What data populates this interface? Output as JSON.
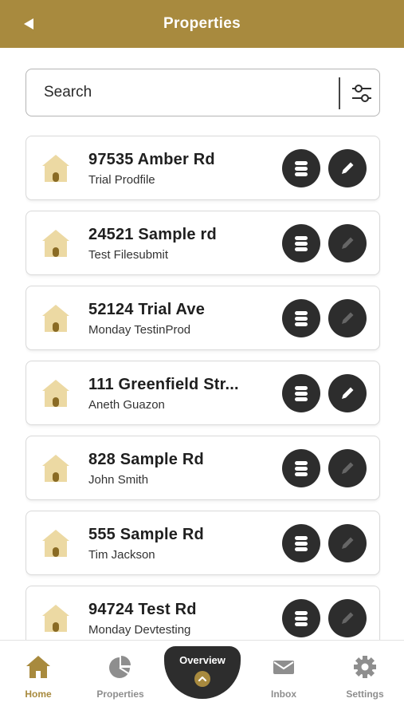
{
  "header": {
    "title": "Properties",
    "back_icon": "back-arrow-icon"
  },
  "search": {
    "placeholder": "Search",
    "value": "",
    "filter_icon": "filter-sliders-icon"
  },
  "properties": [
    {
      "name": "97535 Amber Rd",
      "subtitle": "Trial Prodfile",
      "edit_enabled": true
    },
    {
      "name": "24521 Sample rd",
      "subtitle": "Test Filesubmit",
      "edit_enabled": false
    },
    {
      "name": "52124 Trial Ave",
      "subtitle": "Monday TestinProd",
      "edit_enabled": false
    },
    {
      "name": "111 Greenfield Str...",
      "subtitle": "Aneth Guazon",
      "edit_enabled": true
    },
    {
      "name": "828 Sample Rd",
      "subtitle": "John Smith",
      "edit_enabled": false
    },
    {
      "name": "555 Sample Rd",
      "subtitle": "Tim Jackson",
      "edit_enabled": false
    },
    {
      "name": "94724 Test Rd",
      "subtitle": "Monday Devtesting",
      "edit_enabled": false
    }
  ],
  "bottom_nav": {
    "items": [
      {
        "label": "Home",
        "icon": "home-icon",
        "active": true
      },
      {
        "label": "Properties",
        "icon": "pie-chart-icon",
        "active": false
      },
      {
        "label": "Inbox",
        "icon": "envelope-icon",
        "active": false
      },
      {
        "label": "Settings",
        "icon": "gear-icon",
        "active": false
      }
    ],
    "overview": {
      "label": "Overview",
      "icon": "chevron-up-icon"
    }
  },
  "colors": {
    "brand": "#a88a3e",
    "house_fill": "#ecd9a3",
    "house_door": "#8a6b24",
    "dark_button": "#2d2d2d",
    "inactive_nav": "#8e8e8e"
  }
}
